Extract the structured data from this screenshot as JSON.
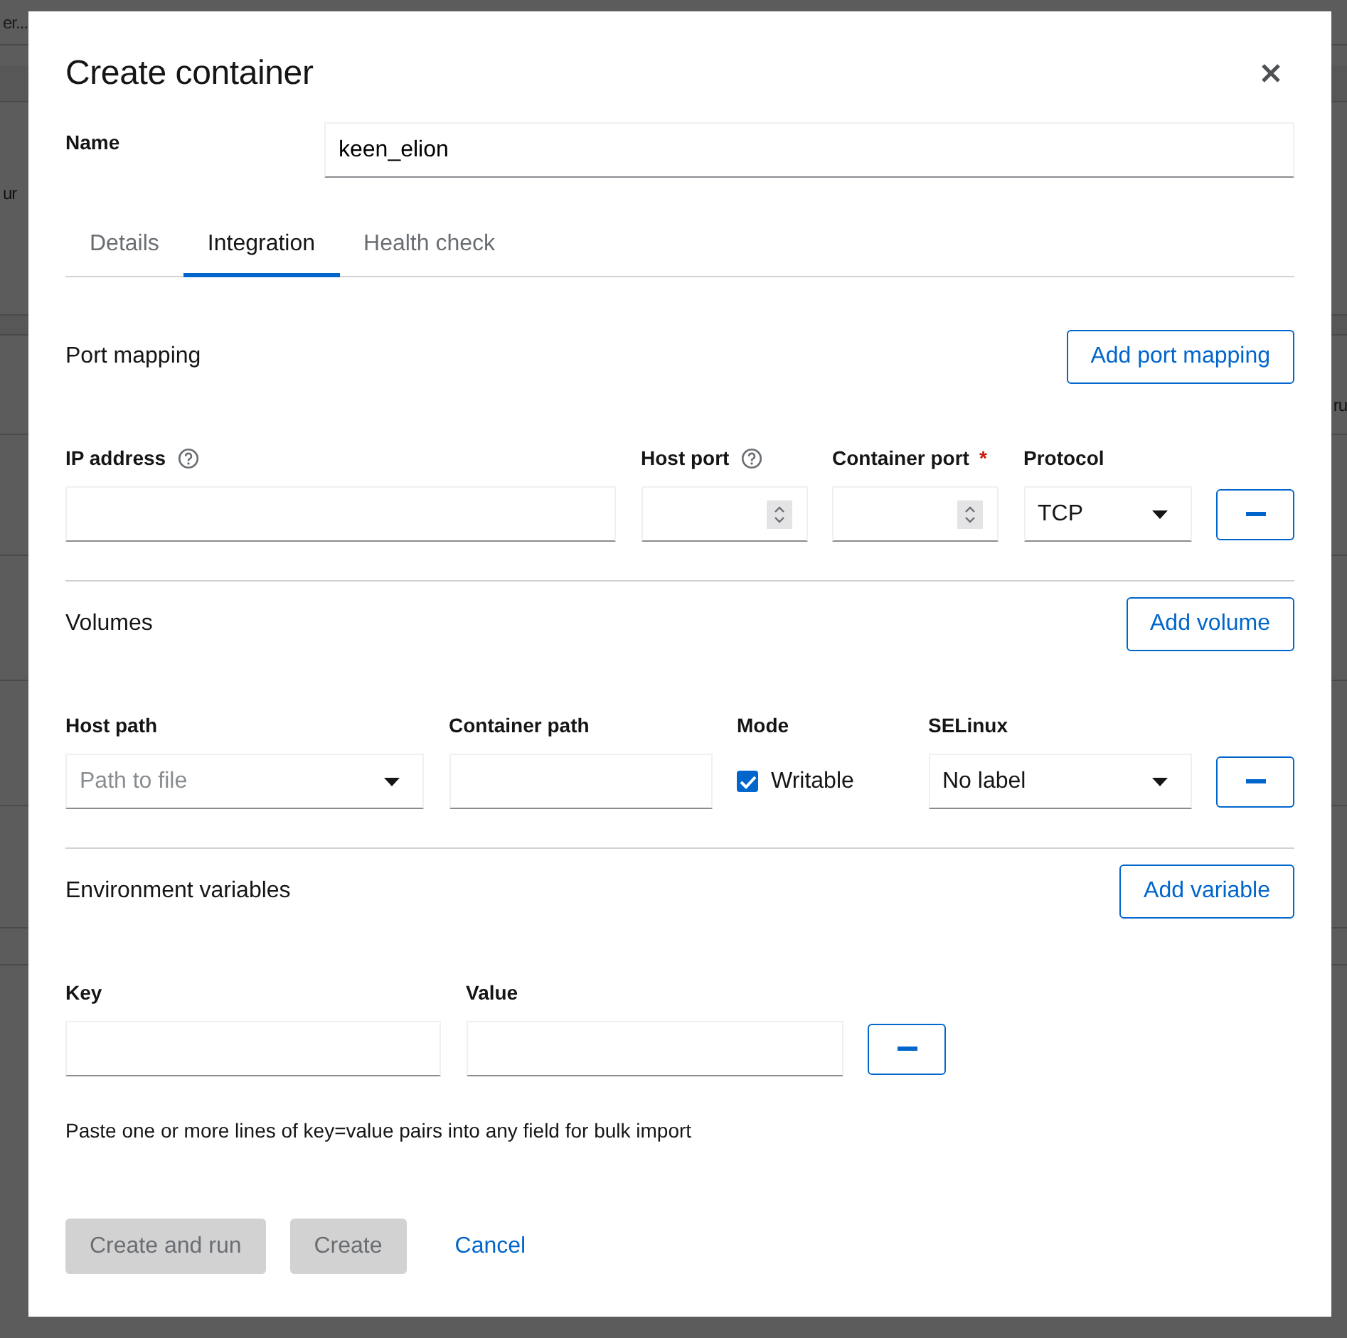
{
  "background_texts": [
    "er...",
    "ur",
    "ru"
  ],
  "dialog": {
    "title": "Create container",
    "name": {
      "label": "Name",
      "value": "keen_elion"
    },
    "tabs": [
      {
        "label": "Details",
        "selected": false
      },
      {
        "label": "Integration",
        "selected": true
      },
      {
        "label": "Health check",
        "selected": false
      }
    ],
    "sections": [
      {
        "title": "Port mapping",
        "add_button": "Add port mapping",
        "fields": [
          {
            "kind": "text",
            "label": "IP address",
            "help": true
          },
          {
            "kind": "number",
            "label": "Host port",
            "help": true
          },
          {
            "kind": "number",
            "label": "Container port",
            "help": false,
            "required_mark": "*"
          },
          {
            "kind": "select",
            "label": "Protocol",
            "help": false,
            "value": "TCP"
          }
        ]
      },
      {
        "title": "Volumes",
        "add_button": "Add volume",
        "fields": [
          {
            "kind": "select",
            "label": "Host path",
            "help": false,
            "placeholder": "Path to file"
          },
          {
            "kind": "text",
            "label": "Container path",
            "help": false
          },
          {
            "kind": "checkbox",
            "label": "Mode",
            "help": false,
            "option": "Writable",
            "checked": true
          },
          {
            "kind": "select",
            "label": "SELinux",
            "help": false,
            "value": "No label"
          }
        ]
      },
      {
        "title": "Environment variables",
        "add_button": "Add variable",
        "fields": [
          {
            "kind": "text",
            "label": "Key",
            "help": false
          },
          {
            "kind": "text",
            "label": "Value",
            "help": false
          }
        ],
        "hint": "Paste one or more lines of key=value pairs into any field for bulk import"
      }
    ],
    "footer": [
      {
        "kind": "button",
        "label": "Create and run",
        "disabled": true
      },
      {
        "kind": "button",
        "label": "Create",
        "disabled": true
      },
      {
        "kind": "link",
        "label": "Cancel",
        "disabled": false
      }
    ]
  }
}
